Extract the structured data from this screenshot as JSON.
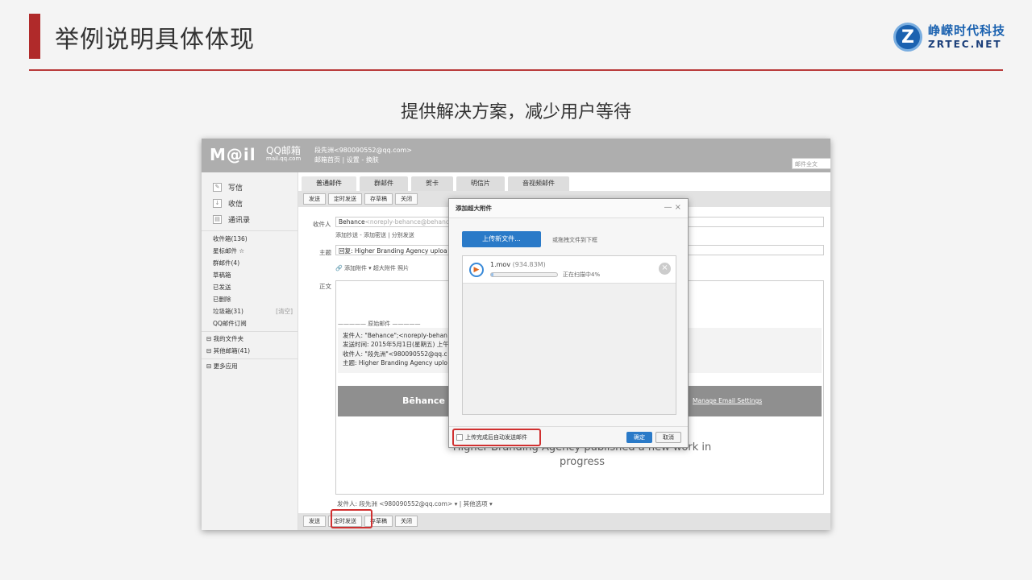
{
  "slide": {
    "title": "举例说明具体体现",
    "subtitle": "提供解决方案，减少用户等待",
    "logo_cn": "峥嵘时代科技",
    "logo_en": "ZRTEC.NET",
    "logo_mark": "Z"
  },
  "mail": {
    "logo": "M@il",
    "logo_name": "QQ邮箱",
    "logo_domain": "mail.qq.com",
    "user": "段先洲<980090552@qq.com>",
    "user_links": "邮箱首页 | 设置 - 换肤",
    "search_placeholder": "邮件全文",
    "sidebar_top": [
      "写信",
      "收信",
      "通讯录"
    ],
    "sidebar_list": [
      "收件箱(136)",
      "星标邮件 ☆",
      "群邮件(4)",
      "草稿箱",
      "已发送",
      "已删除",
      "垃圾箱(31)",
      "QQ邮件订阅"
    ],
    "trash_clear": "[清空]",
    "sidebar_ext": [
      "我的文件夹",
      "其他邮箱(41)",
      "更多应用"
    ],
    "tabs": [
      "普通邮件",
      "群邮件",
      "贺卡",
      "明信片",
      "音视频邮件"
    ],
    "toolbar": [
      "发送",
      "定时发送",
      "存草稿",
      "关闭"
    ],
    "to_label": "收件人",
    "to_value": "Behance",
    "to_hint": "<noreply-behance@behance",
    "to_links": "添加抄送 - 添加密送 | 分别发送",
    "subject_label": "主题",
    "subject_value": "回复: Higher Branding Agency uploa",
    "attach_links": "添加附件 ▾   超大附件   照片",
    "body_label": "正文",
    "orig_label": "————— 原始邮件 —————",
    "quote": [
      "发件人: \"Behance\";<noreply-behan",
      "发送时间: 2015年5月1日(星期五) 上午",
      "收件人: \"段先洲\"<980090552@qq.c",
      "主题: Higher Branding Agency uplo"
    ],
    "behance_logo": "Bēhance",
    "manage_link": "Manage Email Settings",
    "big_text": "Higher Branding Agency published a new work in progress",
    "sender_line": "发件人:   段先洲 <980090552@qq.com> ▾   |   其他选项 ▾"
  },
  "dialog": {
    "title": "添加超大附件",
    "controls": "— ×",
    "upload_button": "上传新文件...",
    "drag_hint": "或拖拽文件到下框",
    "file_name": "1.mov",
    "file_size": "(934.83M)",
    "progress": 0.04,
    "status": "正在扫描中4%",
    "auto_send": "上传完成后自动发送邮件",
    "ok": "确定",
    "cancel": "取消"
  }
}
